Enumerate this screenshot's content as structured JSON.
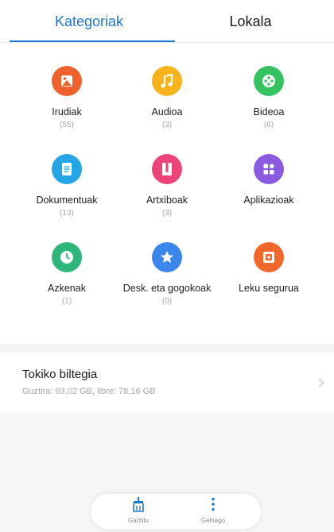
{
  "tabs": {
    "categories": "Kategoriak",
    "local": "Lokala"
  },
  "colors": {
    "accent": "#1a78d2",
    "images": "#f0622d",
    "audio": "#f9b31a",
    "videos": "#35c261",
    "documents": "#23a5e6",
    "archives": "#ec4479",
    "apps": "#8a5be0",
    "recent": "#2eb57a",
    "favorites": "#3a86ec",
    "safe": "#f2682c"
  },
  "categories": [
    {
      "label": "Irudiak",
      "count": "(55)",
      "icon": "image-icon"
    },
    {
      "label": "Audioa",
      "count": "(3)",
      "icon": "music-note-icon"
    },
    {
      "label": "Bideoa",
      "count": "(6)",
      "icon": "film-reel-icon"
    },
    {
      "label": "Dokumentuak",
      "count": "(13)",
      "icon": "document-icon"
    },
    {
      "label": "Artxiboak",
      "count": "(3)",
      "icon": "archive-icon"
    },
    {
      "label": "Aplikazioak",
      "count": "",
      "icon": "apps-grid-icon"
    },
    {
      "label": "Azkenak",
      "count": "(1)",
      "icon": "clock-icon"
    },
    {
      "label": "Desk. eta gogokoak",
      "count": "(0)",
      "icon": "star-icon"
    },
    {
      "label": "Leku segurua",
      "count": "",
      "icon": "safe-icon"
    }
  ],
  "storage": {
    "title": "Tokiko biltegia",
    "details": "Guztira: 93,02 GB, libre: 78,16 GB"
  },
  "bottom_bar": {
    "clean": "Garbitu",
    "settings": "Gehiago"
  }
}
